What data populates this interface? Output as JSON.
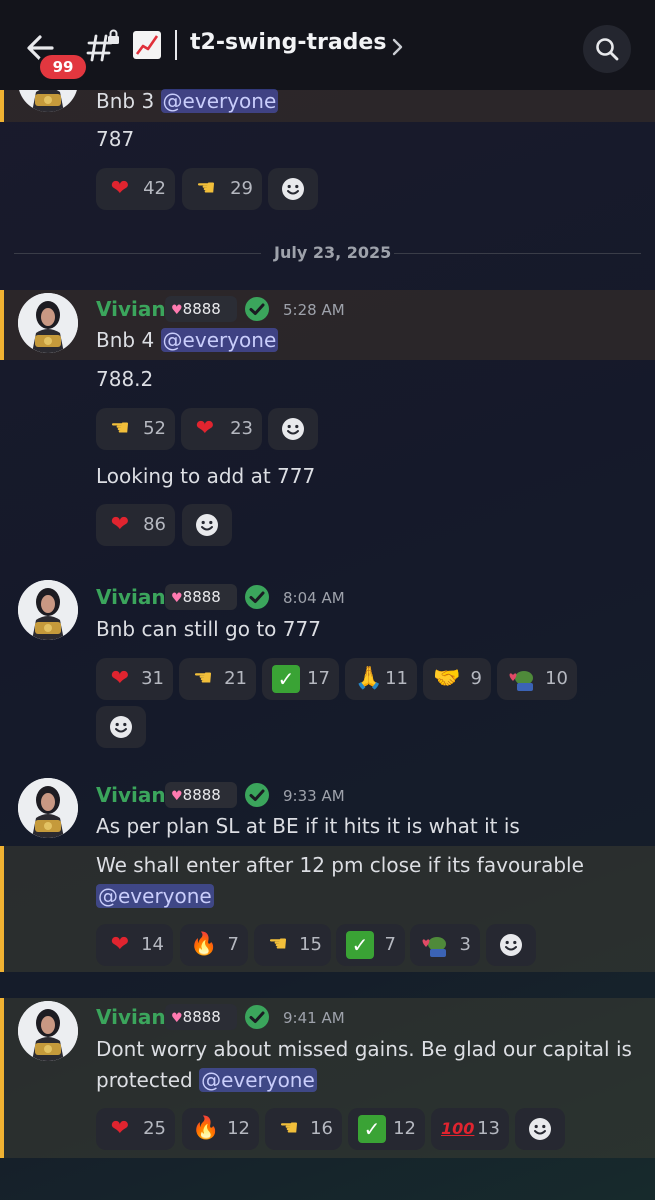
{
  "header": {
    "unread_badge": "99",
    "channel_name": "t2-swing-trades"
  },
  "date_divider": "July 23, 2025",
  "messages": [
    {
      "id": "m0",
      "lines": [
        "Bnb 3",
        "787"
      ],
      "mention": "@everyone",
      "reactions": [
        {
          "emoji": "red-heart",
          "count": "42"
        },
        {
          "emoji": "pointing-hand",
          "count": "29"
        }
      ]
    },
    {
      "id": "m1",
      "author": "Vivian",
      "tag": "8888",
      "time": "5:28 AM",
      "lines": [
        "Bnb 4",
        "788.2"
      ],
      "mention": "@everyone",
      "reactions": [
        {
          "emoji": "pointing-hand",
          "count": "52"
        },
        {
          "emoji": "red-heart",
          "count": "23"
        }
      ],
      "followup": "Looking to add at 777",
      "followup_reactions": [
        {
          "emoji": "red-heart",
          "count": "86"
        }
      ]
    },
    {
      "id": "m2",
      "author": "Vivian",
      "tag": "8888",
      "time": "8:04 AM",
      "lines": [
        "Bnb can still go to 777"
      ],
      "reactions": [
        {
          "emoji": "red-heart",
          "count": "31"
        },
        {
          "emoji": "pointing-hand",
          "count": "21"
        },
        {
          "emoji": "check-mark",
          "count": "17"
        },
        {
          "emoji": "folded-hands",
          "count": "11"
        },
        {
          "emoji": "handshake",
          "count": "9"
        },
        {
          "emoji": "pepe-love",
          "count": "10"
        }
      ]
    },
    {
      "id": "m3",
      "author": "Vivian",
      "tag": "8888",
      "time": "9:33 AM",
      "lines": [
        "As per plan SL at BE if it hits it is what it is",
        "We shall enter after 12 pm close if its favourable"
      ],
      "mention": "@everyone",
      "reactions": [
        {
          "emoji": "red-heart",
          "count": "14"
        },
        {
          "emoji": "fire",
          "count": "7"
        },
        {
          "emoji": "pointing-hand",
          "count": "15"
        },
        {
          "emoji": "check-mark",
          "count": "7"
        },
        {
          "emoji": "pepe-love",
          "count": "3"
        }
      ]
    },
    {
      "id": "m4",
      "author": "Vivian",
      "tag": "8888",
      "time": "9:41 AM",
      "lines": [
        "Dont worry about missed gains. Be glad our capital is",
        "protected"
      ],
      "mention": "@everyone",
      "reactions": [
        {
          "emoji": "red-heart",
          "count": "25"
        },
        {
          "emoji": "fire",
          "count": "12"
        },
        {
          "emoji": "pointing-hand",
          "count": "16"
        },
        {
          "emoji": "check-mark",
          "count": "12"
        },
        {
          "emoji": "hundred-points",
          "count": "13"
        }
      ]
    }
  ],
  "colors": {
    "author": "#3ba55c",
    "highlight_bar": "#f0b232",
    "mention_bg": "#4752c4",
    "badge": "#e2373f"
  }
}
